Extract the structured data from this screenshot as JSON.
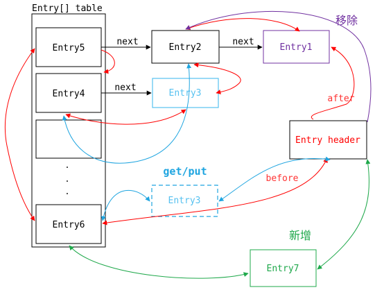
{
  "table": {
    "title": "Entry[] table",
    "slots": [
      "Entry5",
      "Entry4",
      "",
      "...",
      "Entry6"
    ]
  },
  "nodes": {
    "entry2": "Entry2",
    "entry1": "Entry1",
    "entry3_top": "Entry3",
    "entry3_moved": "Entry3",
    "header": "Entry header",
    "entry7": "Entry7"
  },
  "labels": {
    "next_1": "next",
    "next_2": "next",
    "next_3": "next",
    "remove": "移除",
    "after": "after",
    "before": "before",
    "getput": "get/put",
    "add": "新增"
  },
  "colors": {
    "black": "#000000",
    "red": "#ff0000",
    "blue": "#1fa5e0",
    "purple": "#7030a0",
    "green": "#1ea84a",
    "entry1_text": "#7030a0",
    "entry3_text": "#56c1f0",
    "entry7_text": "#1ea84a",
    "header_text": "#ff0000",
    "label_red": "#ff3333"
  }
}
